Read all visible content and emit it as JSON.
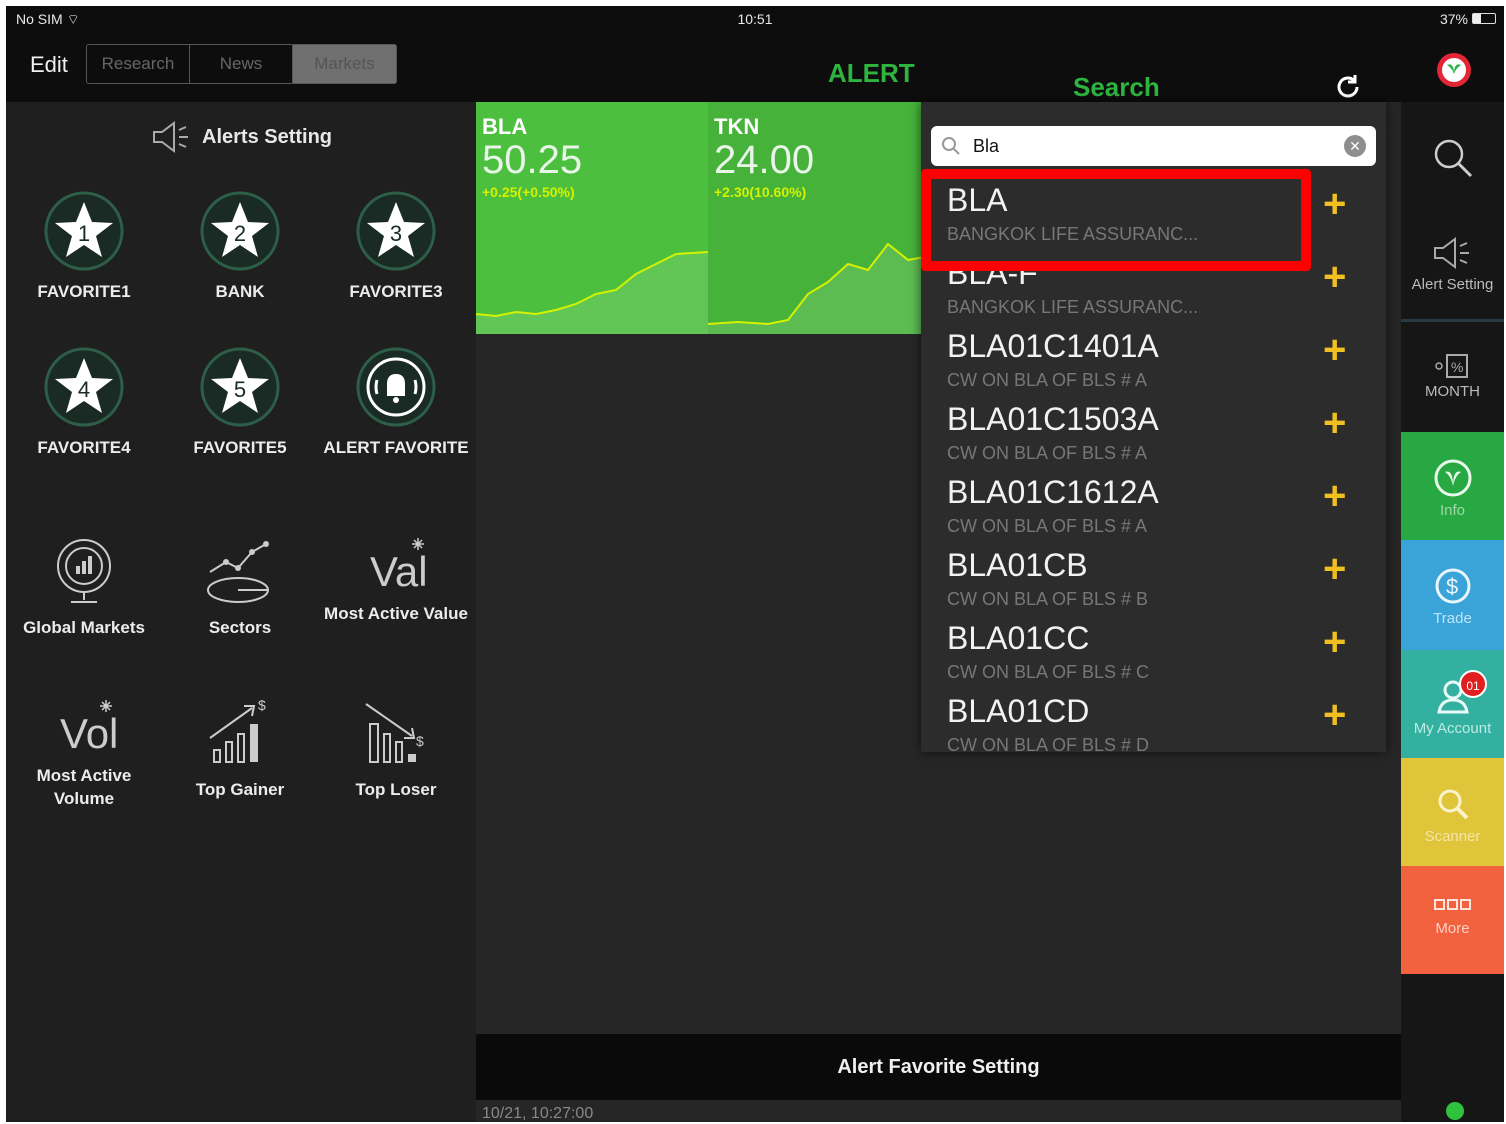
{
  "status_bar": {
    "carrier": "No SIM ⌔",
    "time": "10:51",
    "battery": "37%",
    "battery_level": 0.37
  },
  "nav": {
    "edit": "Edit",
    "tabs": [
      "Research",
      "News",
      "Markets"
    ],
    "active_tab": "Markets",
    "alert_title": "ALERT",
    "search_title": "Search"
  },
  "left_menu": {
    "alerts_setting": "Alerts Setting",
    "favorites": [
      {
        "num": "1",
        "label": "FAVORITE1"
      },
      {
        "num": "2",
        "label": "BANK"
      },
      {
        "num": "3",
        "label": "FAVORITE3"
      },
      {
        "num": "4",
        "label": "FAVORITE4"
      },
      {
        "num": "5",
        "label": "FAVORITE5"
      }
    ],
    "alert_favorite": "ALERT FAVORITE",
    "tools": [
      {
        "label": "Global Markets",
        "icon": "globe-chart-icon"
      },
      {
        "label": "Sectors",
        "icon": "sectors-icon"
      },
      {
        "label": "Most Active Value",
        "icon": "value-icon"
      },
      {
        "label": "Most Active Volume",
        "icon": "volume-icon"
      },
      {
        "label": "Top Gainer",
        "icon": "gainer-icon"
      },
      {
        "label": "Top Loser",
        "icon": "loser-icon"
      }
    ]
  },
  "stocks": [
    {
      "symbol": "BLA",
      "price": "50.25",
      "change": "+0.25(+0.50%)",
      "color": "#4cbf3f"
    },
    {
      "symbol": "TKN",
      "price": "24.00",
      "change": "+2.30(10.60%)",
      "color": "#46b23a"
    }
  ],
  "search": {
    "query": "Bla",
    "results": [
      {
        "symbol": "BLA",
        "name": "BANGKOK LIFE ASSURANC..."
      },
      {
        "symbol": "BLA-F",
        "name": "BANGKOK LIFE ASSURANC..."
      },
      {
        "symbol": "BLA01C1401A",
        "name": "CW ON BLA OF BLS # A"
      },
      {
        "symbol": "BLA01C1503A",
        "name": "CW ON BLA OF BLS # A"
      },
      {
        "symbol": "BLA01C1612A",
        "name": "CW ON BLA OF BLS # A"
      },
      {
        "symbol": "BLA01CB",
        "name": "CW ON BLA OF BLS # B"
      },
      {
        "symbol": "BLA01CC",
        "name": "CW ON BLA OF BLS # C"
      },
      {
        "symbol": "BLA01CD",
        "name": "CW ON BLA OF BLS # D"
      }
    ],
    "highlighted_index": 0
  },
  "alert_favorite_setting": "Alert Favorite Setting",
  "timestamp": "10/21, 10:27:00",
  "sidebar": {
    "alert_setting": "Alert Setting",
    "month": "MONTH",
    "info": "Info",
    "trade": "Trade",
    "my_account": "My Account",
    "my_account_badge": "01",
    "scanner": "Scanner",
    "more": "More",
    "colors": {
      "info": "#27a843",
      "trade": "#3aa3d8",
      "account": "#33b0a0",
      "scanner": "#e0c43a",
      "more": "#f2623e"
    }
  }
}
